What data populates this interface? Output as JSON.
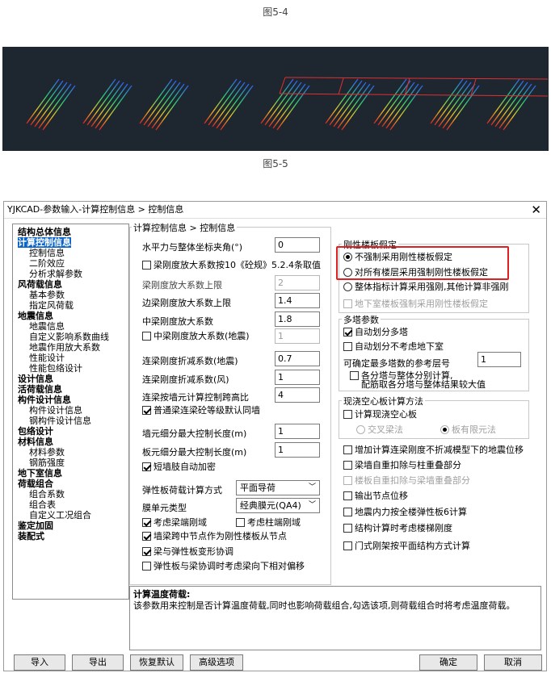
{
  "captions": {
    "fig1": "图5-4",
    "fig2": "图5-5"
  },
  "dialog": {
    "title": "YJKCAD-参数输入-计算控制信息 > 控制信息",
    "close": "✕"
  },
  "tree": [
    {
      "label": "结构总体信息",
      "level": 0,
      "bold": true
    },
    {
      "label": "计算控制信息",
      "level": 0,
      "bold": true,
      "selected": true
    },
    {
      "label": "控制信息",
      "level": 1
    },
    {
      "label": "二阶效应",
      "level": 1
    },
    {
      "label": "分析求解参数",
      "level": 1
    },
    {
      "label": "风荷载信息",
      "level": 0,
      "bold": true
    },
    {
      "label": "基本参数",
      "level": 1
    },
    {
      "label": "指定风荷载",
      "level": 1
    },
    {
      "label": "地震信息",
      "level": 0,
      "bold": true
    },
    {
      "label": "地震信息",
      "level": 1
    },
    {
      "label": "自定义影响系数曲线",
      "level": 1
    },
    {
      "label": "地震作用放大系数",
      "level": 1
    },
    {
      "label": "性能设计",
      "level": 1
    },
    {
      "label": "性能包络设计",
      "level": 1
    },
    {
      "label": "设计信息",
      "level": 0,
      "bold": true
    },
    {
      "label": "活荷载信息",
      "level": 0,
      "bold": true
    },
    {
      "label": "构件设计信息",
      "level": 0,
      "bold": true
    },
    {
      "label": "构件设计信息",
      "level": 1
    },
    {
      "label": "钢构件设计信息",
      "level": 1
    },
    {
      "label": "包络设计",
      "level": 0,
      "bold": true
    },
    {
      "label": "材料信息",
      "level": 0,
      "bold": true
    },
    {
      "label": "材料参数",
      "level": 1
    },
    {
      "label": "钢筋强度",
      "level": 1
    },
    {
      "label": "地下室信息",
      "level": 0,
      "bold": true
    },
    {
      "label": "荷载组合",
      "level": 0,
      "bold": true
    },
    {
      "label": "组合系数",
      "level": 1
    },
    {
      "label": "组合表",
      "level": 1
    },
    {
      "label": "自定义工况组合",
      "level": 1
    },
    {
      "label": "鉴定加固",
      "level": 0,
      "bold": true
    },
    {
      "label": "装配式",
      "level": 0,
      "bold": true
    }
  ],
  "left": {
    "group_title": "计算控制信息 > 控制信息",
    "angle_label": "水平力与整体坐标夹角(°)",
    "angle_val": "0",
    "cb_beam10": "梁刚度放大系数按10《砼规》5.2.4条取值",
    "beam_max_label": "梁刚度放大系数上限",
    "beam_max_val": "2",
    "edge_beam_label": "边梁刚度放大系数上限",
    "edge_beam_val": "1.4",
    "mid_beam_label": "中梁刚度放大系数",
    "mid_beam_val": "1.8",
    "cb_mid_eq": "中梁刚度放大系数(地震)",
    "mid_eq_val": "1",
    "link_eq_label": "连梁刚度折减系数(地震)",
    "link_eq_val": "0.7",
    "link_wind_label": "连梁刚度折减系数(风)",
    "link_wind_val": "1",
    "link_ratio_label": "连梁按墙元计算控制跨高比",
    "link_ratio_val": "4",
    "cb_link_grade": "普通梁连梁砼等级默认同墙",
    "wall_len_label": "墙元细分最大控制长度(m)",
    "wall_len_val": "1",
    "slab_len_label": "板元细分最大控制长度(m)",
    "slab_len_val": "1",
    "cb_short_wall": "短墙肢自动加密",
    "slab_method_label": "弹性板荷载计算方式",
    "slab_method_val": "平面导荷",
    "membrane_label": "膜单元类型",
    "membrane_val": "经典膜元(QA4)",
    "cb_beam_rigid": "考虑梁端刚域",
    "cb_col_rigid": "考虑柱端刚域",
    "cb_wall_node": "墙梁跨中节点作为刚性楼板从节点",
    "cb_beam_slab": "梁与弹性板变形协调",
    "cb_slab_offset": "弹性板与梁协调时考虑梁向下相对偏移"
  },
  "right": {
    "rigid_title": "刚性楼板假定",
    "r1": "不强制采用刚性楼板假定",
    "r2": "对所有楼层采用强制刚性楼板假定",
    "r3": "整体指标计算采用强刚,其他计算非强刚",
    "cb_basement": "地下室楼板强制采用刚性楼板假定",
    "multi_title": "多塔参数",
    "cb_auto_tower": "自动划分多塔",
    "cb_no_basement": "自动划分不考虑地下室",
    "ref_floor_label": "可确定最多塔数的参考层号",
    "ref_floor_val": "1",
    "cb_tower_calc1": "各分塔与整体分别计算,",
    "cb_tower_calc2": "配筋取各分塔与整体结果较大值",
    "hollow_title": "现浇空心板计算方法",
    "cb_hollow": "计算现浇空心板",
    "r_cross": "交叉梁法",
    "r_fem": "板有限元法",
    "cb_1": "增加计算连梁刚度不折减模型下的地震位移",
    "cb_2": "梁墙自重扣除与柱重叠部分",
    "cb_3": "楼板自重扣除与梁墙重叠部分",
    "cb_4": "输出节点位移",
    "cb_5": "地震内力按全楼弹性板6计算",
    "cb_6": "结构计算时考虑楼梯刚度",
    "cb_7": "门式刚架按平面结构方式计算"
  },
  "desc": {
    "title": "计算温度荷载:",
    "text": "该参数用来控制是否计算温度荷载,同时也影响荷载组合,勾选该项,则荷载组合时将考虑温度荷载。"
  },
  "buttons": {
    "import": "导入",
    "export": "导出",
    "restore": "恢复默认",
    "advanced": "高级选项",
    "ok": "确定",
    "cancel": "取消"
  }
}
